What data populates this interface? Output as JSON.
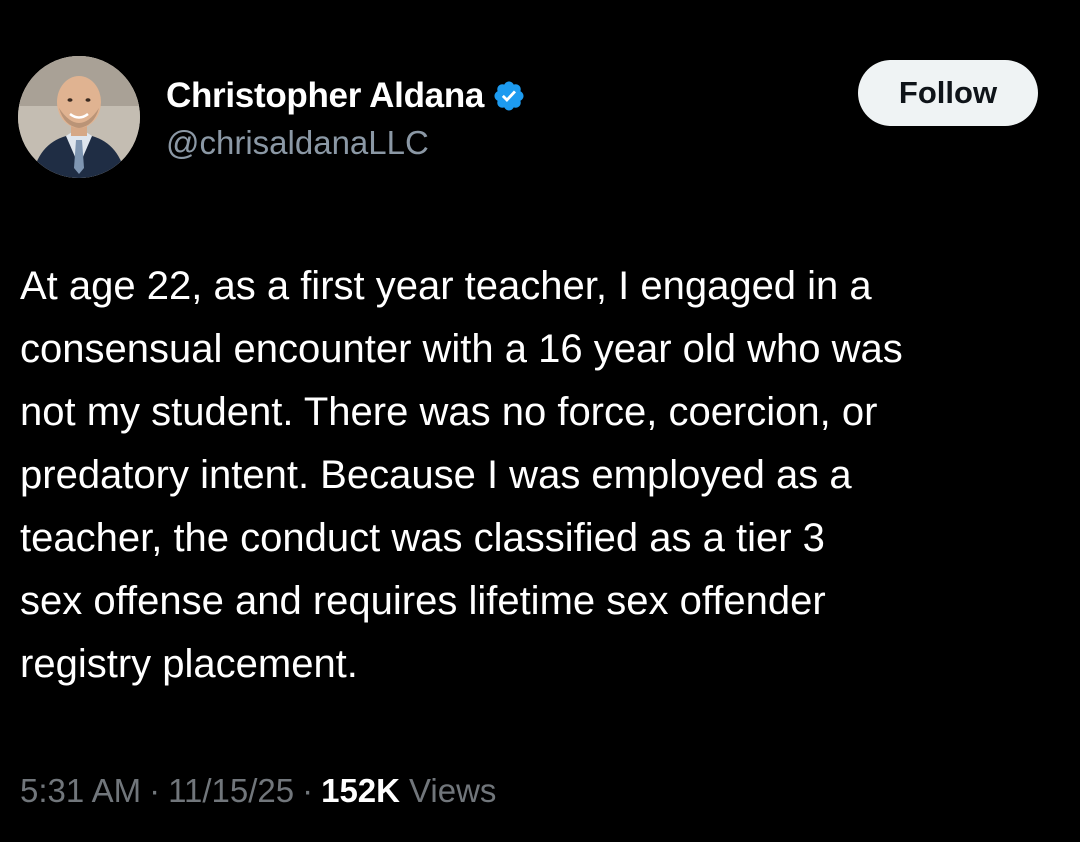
{
  "author": {
    "display_name": "Christopher Aldana",
    "handle": "@chrisaldanaLLC",
    "verified_icon": "verified-badge-icon",
    "avatar": "profile-photo"
  },
  "follow_button": {
    "label": "Follow"
  },
  "tweet": {
    "lines": [
      "At age 22, as a first year teacher, I engaged in a",
      "consensual encounter with a 16 year old who was",
      "not my student. There was no force, coercion, or",
      "predatory intent. Because I was employed as a",
      "teacher, the conduct was classified as a tier 3",
      "sex offense and requires lifetime sex offender",
      "registry placement."
    ]
  },
  "meta": {
    "time": "5:31 AM",
    "date": "11/15/25",
    "separator": "·",
    "views_count": "152K",
    "views_label": "Views"
  },
  "colors": {
    "background": "#000000",
    "text_primary": "#ffffff",
    "text_secondary": "#71767b",
    "verified_blue": "#1d9bf0",
    "follow_button_bg": "#eff3f4"
  }
}
